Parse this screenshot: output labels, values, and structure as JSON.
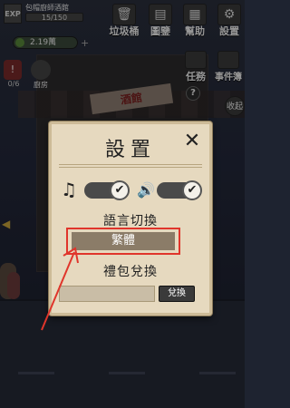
{
  "hud": {
    "exp_label": "EXP",
    "shop_name": "包帽廚師酒館",
    "exp_progress": "15/150",
    "money": "2.19萬",
    "plus": "+",
    "alert_count": "0/6",
    "kitchen_label": "廚房"
  },
  "top_buttons": [
    {
      "label": "垃圾桶",
      "icon": "trash-icon"
    },
    {
      "label": "圖鑒",
      "icon": "book-icon"
    },
    {
      "label": "幫助",
      "icon": "help-icon"
    },
    {
      "label": "設置",
      "icon": "gear-icon"
    }
  ],
  "side_buttons": {
    "task": "任務",
    "events": "事件簿",
    "help_mark": "?",
    "collapse": "收起"
  },
  "scene": {
    "shop_sign": "酒館"
  },
  "settings": {
    "title": "設置",
    "close": "✕",
    "music_icon": "♫",
    "sound_icon": "🔊",
    "check": "✔",
    "language_label": "語言切換",
    "language_value": "繁體",
    "gift_label": "禮包兌換",
    "gift_placeholder": "",
    "redeem_button": "兌換",
    "highlight_color": "#e0352b"
  }
}
